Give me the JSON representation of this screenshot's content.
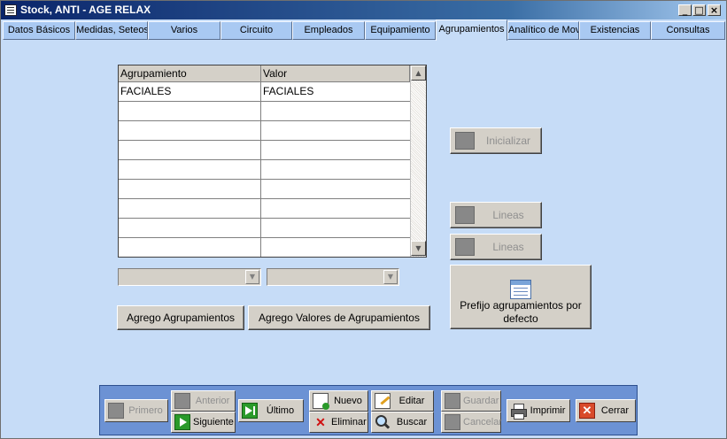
{
  "window": {
    "title": "Stock, ANTI - AGE RELAX",
    "min_glyph": "_",
    "max_glyph": "□",
    "close_glyph": "×"
  },
  "tabs": [
    {
      "label": "Datos Básicos"
    },
    {
      "label": "Medidas, Seteos"
    },
    {
      "label": "Varios"
    },
    {
      "label": "Circuito"
    },
    {
      "label": "Empleados"
    },
    {
      "label": "Equipamiento"
    },
    {
      "label": "Agrupamientos",
      "active": true
    },
    {
      "label": "Analítico de Mov"
    },
    {
      "label": "Existencias"
    },
    {
      "label": "Consultas"
    }
  ],
  "grid": {
    "columns": [
      "Agrupamiento",
      "Valor"
    ],
    "rows": [
      [
        "FACIALES",
        "FACIALES"
      ],
      [
        "",
        ""
      ],
      [
        "",
        ""
      ],
      [
        "",
        ""
      ],
      [
        "",
        ""
      ],
      [
        "",
        ""
      ],
      [
        "",
        ""
      ],
      [
        "",
        ""
      ],
      [
        "",
        ""
      ]
    ],
    "scroll_up": "▲",
    "scroll_down": "▼"
  },
  "combos": {
    "arrow": "▼"
  },
  "buttons": {
    "agrego_agrupamientos": "Agrego Agrupamientos",
    "agrego_valores": "Agrego Valores de Agrupamientos",
    "inicializar": "Inicializar",
    "lineas_1": "Lineas",
    "lineas_2": "Lineas",
    "prefijo": "Prefijo agrupamientos por defecto"
  },
  "toolbar": {
    "primero": "Primero",
    "anterior": "Anterior",
    "siguiente": "Siguiente",
    "ultimo": "Último",
    "nuevo": "Nuevo",
    "eliminar": "Eliminar",
    "editar": "Editar",
    "buscar": "Buscar",
    "guardar": "Guardar",
    "cancelar": "Cancelar",
    "imprimir": "Imprimir",
    "cerrar": "Cerrar"
  },
  "colors": {
    "window_bg": "#c6dcf7",
    "toolbar_bg": "#6c92d4",
    "titlebar": "#0a246a"
  }
}
